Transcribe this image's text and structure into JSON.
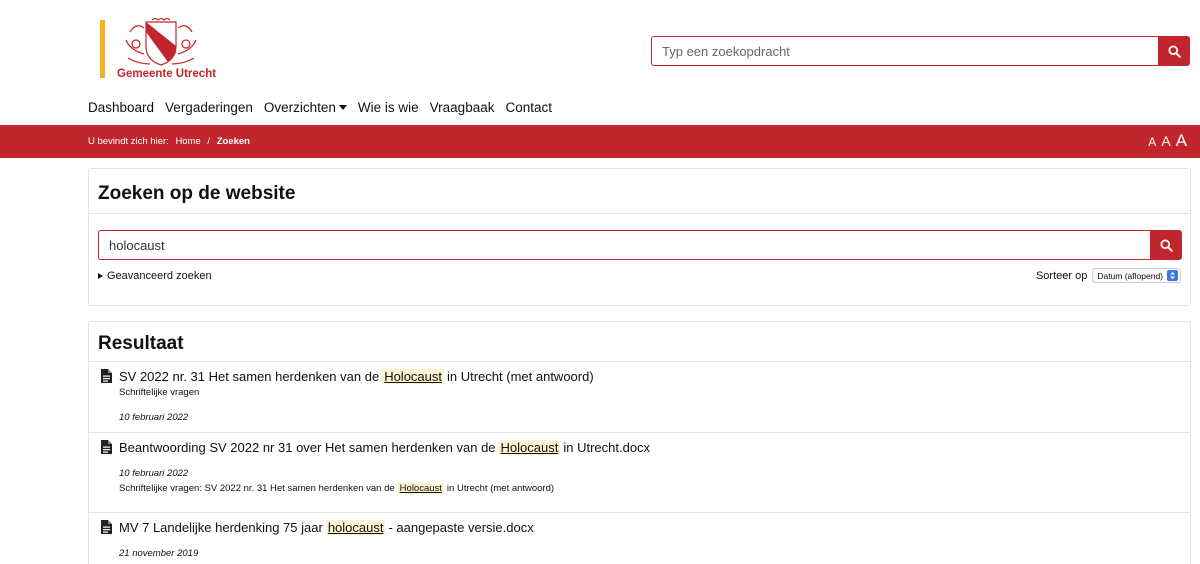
{
  "brand": {
    "name": "Gemeente Utrecht"
  },
  "header": {
    "search_placeholder": "Typ een zoekopdracht",
    "nav": [
      {
        "label": "Dashboard"
      },
      {
        "label": "Vergaderingen"
      },
      {
        "label": "Overzichten"
      },
      {
        "label": "Wie is wie"
      },
      {
        "label": "Vraagbaak"
      },
      {
        "label": "Contact"
      }
    ]
  },
  "breadcrumb": {
    "prefix": "U bevindt zich hier:",
    "home": "Home",
    "separator": "/",
    "current": "Zoeken"
  },
  "font_sizer": {
    "small": "A",
    "medium": "A",
    "large": "A"
  },
  "search_card": {
    "title": "Zoeken op de website",
    "query": "holocaust",
    "advanced_label": "Geavanceerd zoeken",
    "sort_label": "Sorteer op",
    "sort_value": "Datum (aflopend)"
  },
  "results_card": {
    "title": "Resultaat",
    "results": [
      {
        "title_before": "SV 2022 nr. 31 Het samen herdenken van de",
        "title_hit": "Holocaust",
        "title_after": "in Utrecht (met antwoord)",
        "category": "Schriftelijke vragen",
        "date": "10 februari 2022"
      },
      {
        "title_before": "Beantwoording SV 2022 nr 31 over Het samen herdenken van de",
        "title_hit": "Holocaust",
        "title_after": "in Utrecht.docx",
        "date": "10 februari 2022",
        "context_before": "Schriftelijke vragen: SV 2022 nr. 31 Het samen herdenken van de",
        "context_hit": "Holocaust",
        "context_after": "in Utrecht (met antwoord)"
      },
      {
        "title_before": "MV 7 Landelijke herdenking 75 jaar",
        "title_hit": "holocaust",
        "title_after": "- aangepaste versie.docx",
        "date": "21 november 2019"
      }
    ]
  },
  "colors": {
    "brand_red": "#c1262c",
    "brand_yellow": "#f3b01a",
    "highlight": "#fcf3cf"
  }
}
